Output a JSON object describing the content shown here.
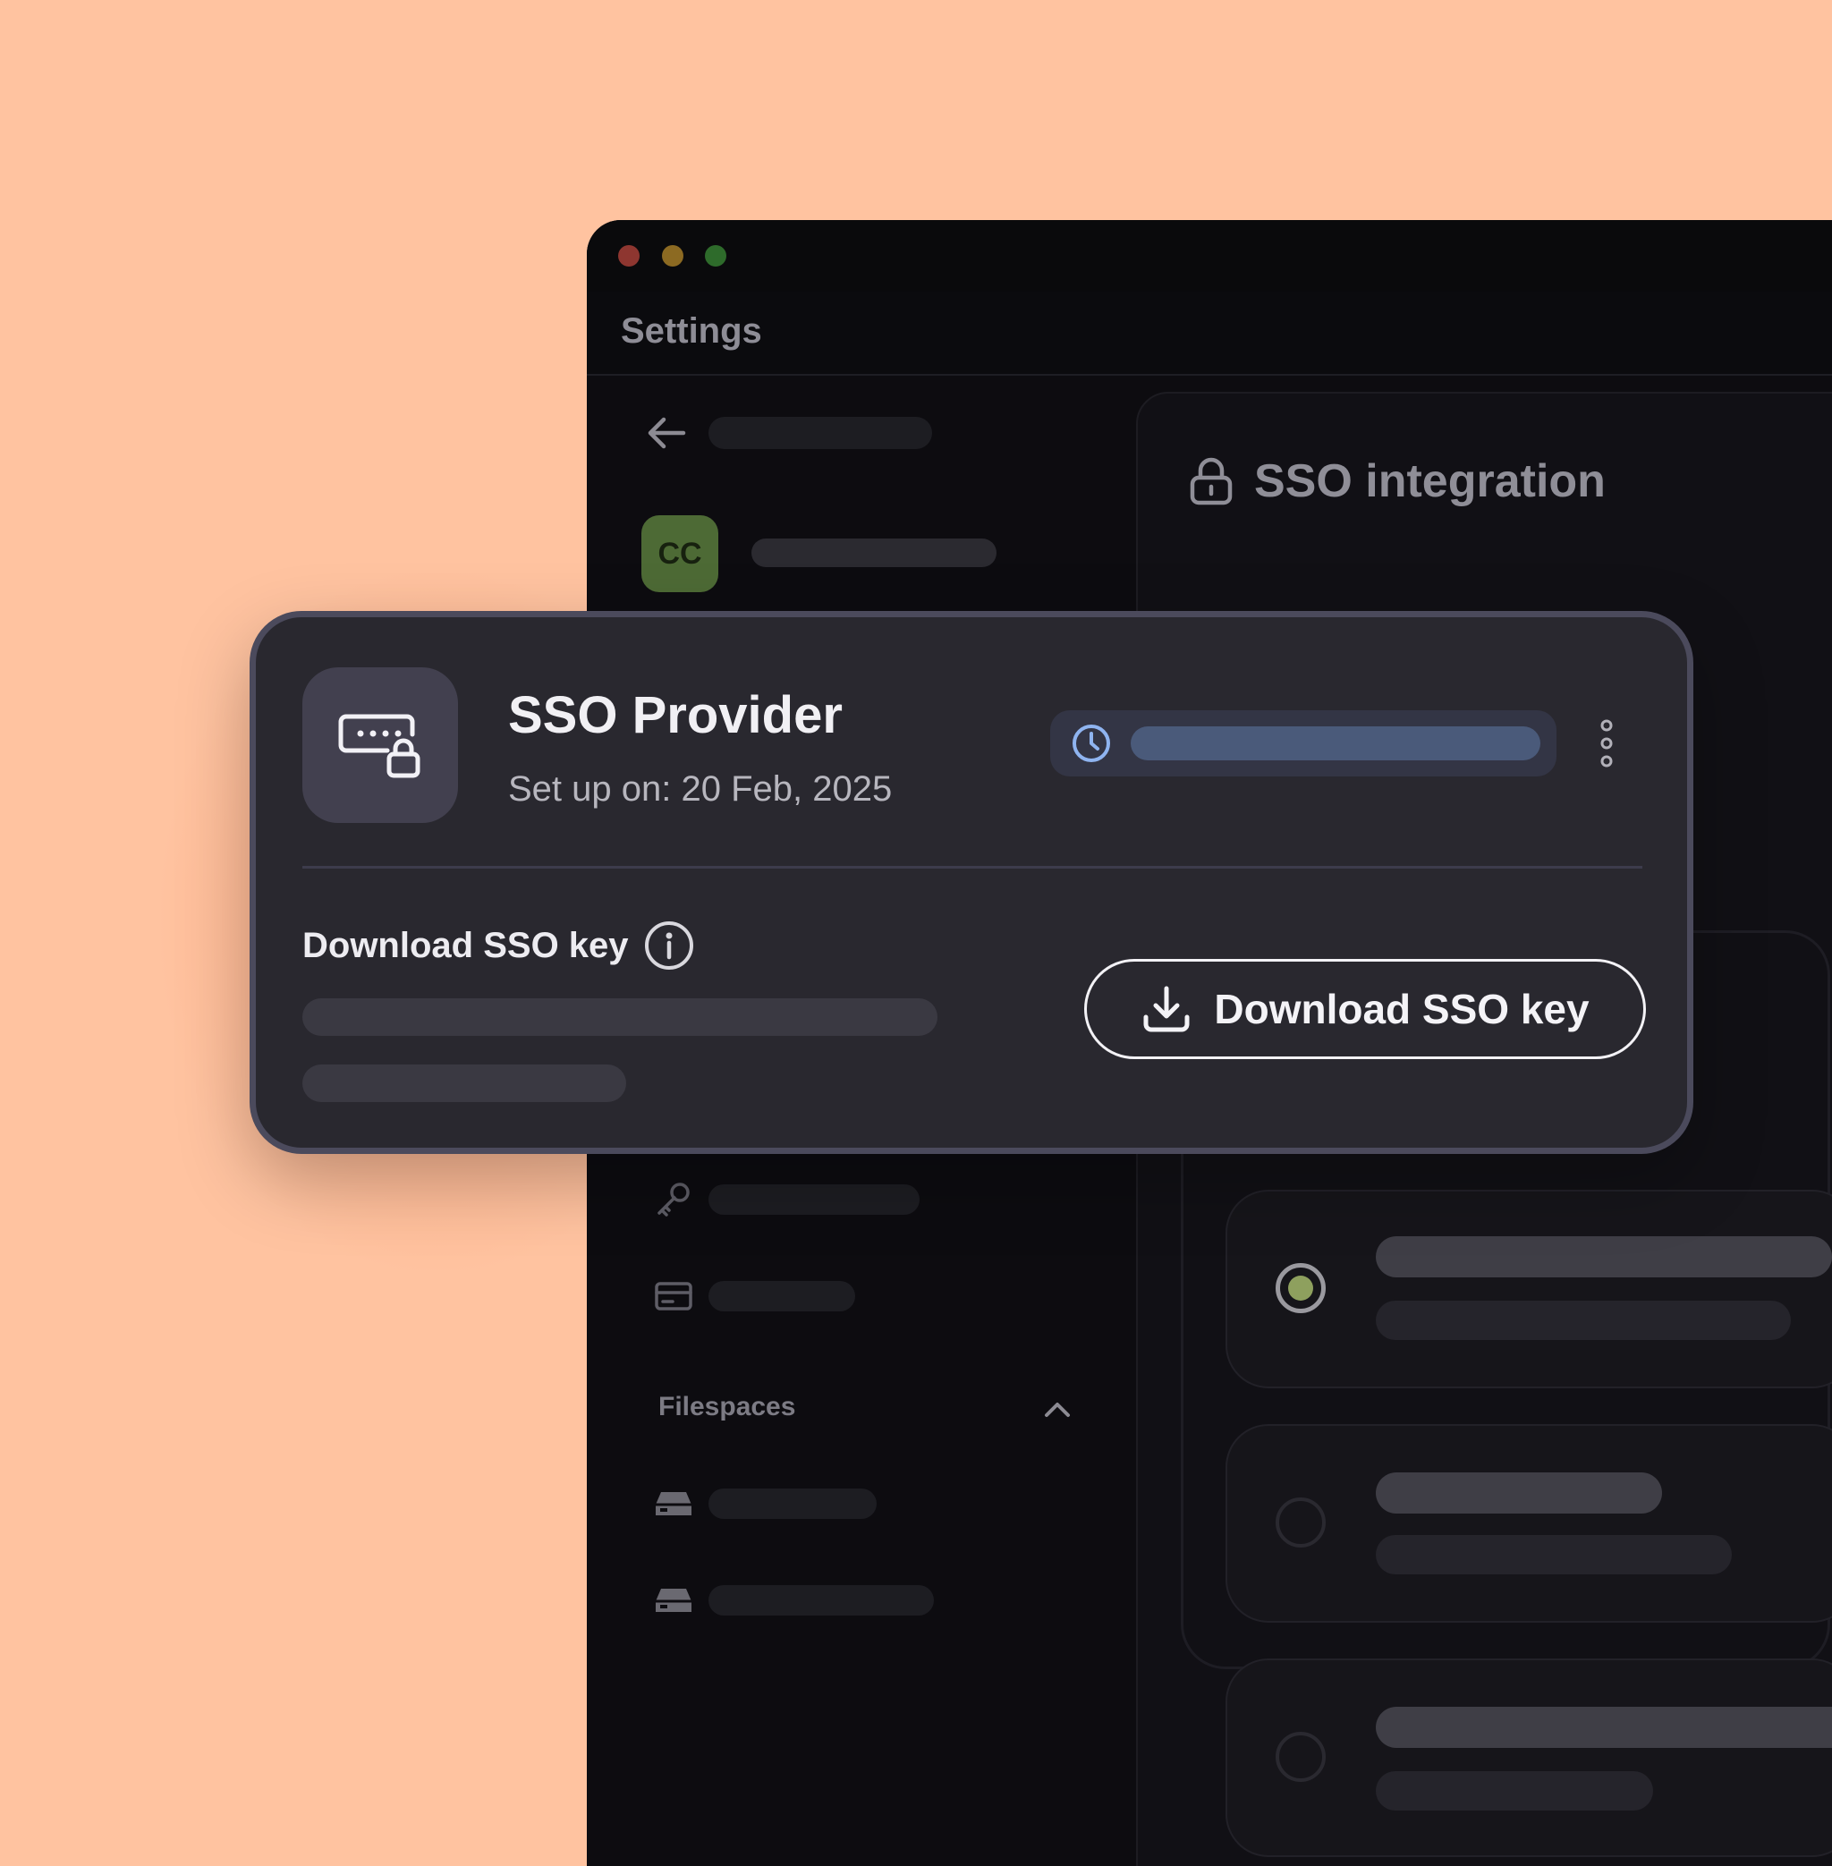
{
  "window": {
    "header_title": "Settings"
  },
  "sidebar": {
    "avatar_initials": "CC",
    "section_label": "Filespaces"
  },
  "main": {
    "title": "SSO integration"
  },
  "sso_card": {
    "provider_name": "SSO Provider",
    "setup_date": "Set up on: 20 Feb, 2025",
    "download_label": "Download SSO key",
    "download_button_label": "Download SSO key"
  },
  "icons": {
    "back": "arrow-left-icon",
    "key": "key-icon",
    "card": "credit-card-icon",
    "drive": "hard-drive-icon",
    "chevron": "chevron-up-icon",
    "lock": "lock-icon",
    "provider": "password-lock-icon",
    "clock": "clock-icon",
    "more": "more-vertical-icon",
    "info": "info-icon",
    "download": "download-icon"
  },
  "colors": {
    "background": "#FFC3A0",
    "window": "#0D0C10",
    "card": "#29282F",
    "card_border": "#4B4A5C",
    "avatar": "#4D6A35",
    "selected_radio": "#8EA05E",
    "clock_accent": "#8FB4F0"
  }
}
